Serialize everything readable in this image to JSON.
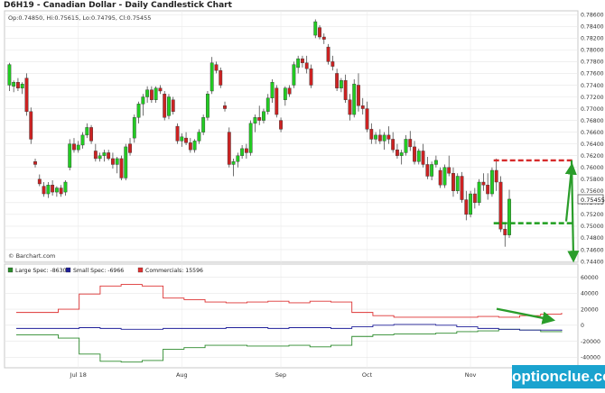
{
  "chart_title": "D6H19 - Canadian Dollar - Daily Candlestick Chart",
  "ohlc_readout": "Op:0.74850, Hi:0.75615, Lo:0.74795, Cl:0.75455",
  "last_price_label": "0.75455",
  "source_label": "© Barchart.com",
  "watermark": "optionclue.com",
  "colors": {
    "up": "#22cc22",
    "down": "#cc2222",
    "large_spec": "#2b8a2b",
    "small_spec": "#1f1f99",
    "commercials": "#dd3333",
    "annotation": "#2a9d2a",
    "level_red": "#d62b2b",
    "level_green": "#1e9e1e"
  },
  "chart_data": [
    {
      "type": "candlestick",
      "title": "D6H19 - Canadian Dollar - Daily Candlestick Chart",
      "yticks": [
        "0.78600",
        "0.78400",
        "0.78200",
        "0.78000",
        "0.77800",
        "0.77600",
        "0.77400",
        "0.77200",
        "0.77000",
        "0.76800",
        "0.76600",
        "0.76400",
        "0.76200",
        "0.76000",
        "0.75800",
        "0.75600",
        "0.75400",
        "0.75200",
        "0.75000",
        "0.74800",
        "0.74600",
        "0.74400"
      ],
      "ylim": [
        0.744,
        0.7865
      ],
      "xticks": [
        {
          "label": "Jul 18",
          "index": 16
        },
        {
          "label": "Aug",
          "index": 40
        },
        {
          "label": "Sep",
          "index": 63
        },
        {
          "label": "Oct",
          "index": 83
        },
        {
          "label": "Nov",
          "index": 107
        }
      ],
      "num_slots": 132,
      "ohlc": [
        {
          "o": 0.774,
          "h": 0.7778,
          "l": 0.773,
          "c": 0.7775
        },
        {
          "o": 0.7738,
          "h": 0.7748,
          "l": 0.7728,
          "c": 0.7745
        },
        {
          "o": 0.7745,
          "h": 0.7752,
          "l": 0.773,
          "c": 0.7735
        },
        {
          "o": 0.7735,
          "h": 0.7745,
          "l": 0.7725,
          "c": 0.7742
        },
        {
          "o": 0.7752,
          "h": 0.776,
          "l": 0.7688,
          "c": 0.7695
        },
        {
          "o": 0.7695,
          "h": 0.7702,
          "l": 0.764,
          "c": 0.7648
        },
        {
          "o": 0.761,
          "h": 0.7615,
          "l": 0.76,
          "c": 0.7605
        },
        {
          "o": 0.758,
          "h": 0.7588,
          "l": 0.7568,
          "c": 0.7572
        },
        {
          "o": 0.7568,
          "h": 0.7575,
          "l": 0.755,
          "c": 0.7555
        },
        {
          "o": 0.7555,
          "h": 0.7575,
          "l": 0.7548,
          "c": 0.757
        },
        {
          "o": 0.757,
          "h": 0.7578,
          "l": 0.7552,
          "c": 0.7558
        },
        {
          "o": 0.7558,
          "h": 0.7568,
          "l": 0.755,
          "c": 0.7565
        },
        {
          "o": 0.7565,
          "h": 0.757,
          "l": 0.755,
          "c": 0.7555
        },
        {
          "o": 0.7558,
          "h": 0.7578,
          "l": 0.7552,
          "c": 0.7575
        },
        {
          "o": 0.76,
          "h": 0.7648,
          "l": 0.7595,
          "c": 0.764
        },
        {
          "o": 0.764,
          "h": 0.765,
          "l": 0.7625,
          "c": 0.763
        },
        {
          "o": 0.763,
          "h": 0.7645,
          "l": 0.7625,
          "c": 0.7638
        },
        {
          "o": 0.7638,
          "h": 0.766,
          "l": 0.7632,
          "c": 0.7655
        },
        {
          "o": 0.7655,
          "h": 0.7675,
          "l": 0.765,
          "c": 0.7668
        },
        {
          "o": 0.7668,
          "h": 0.7672,
          "l": 0.764,
          "c": 0.7645
        },
        {
          "o": 0.7628,
          "h": 0.764,
          "l": 0.761,
          "c": 0.7615
        },
        {
          "o": 0.7615,
          "h": 0.7625,
          "l": 0.761,
          "c": 0.762
        },
        {
          "o": 0.762,
          "h": 0.763,
          "l": 0.761,
          "c": 0.7625
        },
        {
          "o": 0.7625,
          "h": 0.763,
          "l": 0.7612,
          "c": 0.7615
        },
        {
          "o": 0.7615,
          "h": 0.7625,
          "l": 0.7598,
          "c": 0.7605
        },
        {
          "o": 0.7605,
          "h": 0.7618,
          "l": 0.759,
          "c": 0.7615
        },
        {
          "o": 0.7615,
          "h": 0.762,
          "l": 0.7578,
          "c": 0.7582
        },
        {
          "o": 0.7582,
          "h": 0.764,
          "l": 0.7578,
          "c": 0.7635
        },
        {
          "o": 0.764,
          "h": 0.765,
          "l": 0.762,
          "c": 0.7625
        },
        {
          "o": 0.765,
          "h": 0.769,
          "l": 0.7642,
          "c": 0.7685
        },
        {
          "o": 0.7685,
          "h": 0.7712,
          "l": 0.7675,
          "c": 0.7708
        },
        {
          "o": 0.7708,
          "h": 0.7725,
          "l": 0.7688,
          "c": 0.772
        },
        {
          "o": 0.772,
          "h": 0.7738,
          "l": 0.771,
          "c": 0.7732
        },
        {
          "o": 0.7732,
          "h": 0.7738,
          "l": 0.771,
          "c": 0.7715
        },
        {
          "o": 0.7715,
          "h": 0.7738,
          "l": 0.771,
          "c": 0.7735
        },
        {
          "o": 0.7735,
          "h": 0.774,
          "l": 0.7725,
          "c": 0.773
        },
        {
          "o": 0.7725,
          "h": 0.773,
          "l": 0.768,
          "c": 0.7685
        },
        {
          "o": 0.7688,
          "h": 0.7725,
          "l": 0.7682,
          "c": 0.772
        },
        {
          "o": 0.7715,
          "h": 0.772,
          "l": 0.769,
          "c": 0.7695
        },
        {
          "o": 0.767,
          "h": 0.7675,
          "l": 0.764,
          "c": 0.7645
        },
        {
          "o": 0.7645,
          "h": 0.7658,
          "l": 0.7635,
          "c": 0.7652
        },
        {
          "o": 0.765,
          "h": 0.766,
          "l": 0.7638,
          "c": 0.7642
        },
        {
          "o": 0.7642,
          "h": 0.765,
          "l": 0.7625,
          "c": 0.763
        },
        {
          "o": 0.763,
          "h": 0.7648,
          "l": 0.7625,
          "c": 0.7645
        },
        {
          "o": 0.7645,
          "h": 0.7665,
          "l": 0.764,
          "c": 0.766
        },
        {
          "o": 0.766,
          "h": 0.769,
          "l": 0.7655,
          "c": 0.7685
        },
        {
          "o": 0.7685,
          "h": 0.773,
          "l": 0.768,
          "c": 0.7725
        },
        {
          "o": 0.773,
          "h": 0.7788,
          "l": 0.7725,
          "c": 0.7778
        },
        {
          "o": 0.7775,
          "h": 0.778,
          "l": 0.776,
          "c": 0.7765
        },
        {
          "o": 0.7765,
          "h": 0.777,
          "l": 0.7735,
          "c": 0.774
        },
        {
          "o": 0.7705,
          "h": 0.7712,
          "l": 0.7695,
          "c": 0.77
        },
        {
          "o": 0.766,
          "h": 0.7668,
          "l": 0.76,
          "c": 0.7605
        },
        {
          "o": 0.7605,
          "h": 0.7615,
          "l": 0.7585,
          "c": 0.761
        },
        {
          "o": 0.761,
          "h": 0.7625,
          "l": 0.76,
          "c": 0.762
        },
        {
          "o": 0.762,
          "h": 0.7638,
          "l": 0.7615,
          "c": 0.7632
        },
        {
          "o": 0.7632,
          "h": 0.764,
          "l": 0.7615,
          "c": 0.7625
        },
        {
          "o": 0.7625,
          "h": 0.768,
          "l": 0.762,
          "c": 0.7675
        },
        {
          "o": 0.7675,
          "h": 0.769,
          "l": 0.766,
          "c": 0.7685
        },
        {
          "o": 0.7685,
          "h": 0.7705,
          "l": 0.7672,
          "c": 0.768
        },
        {
          "o": 0.768,
          "h": 0.77,
          "l": 0.7675,
          "c": 0.7695
        },
        {
          "o": 0.7695,
          "h": 0.7725,
          "l": 0.769,
          "c": 0.7718
        },
        {
          "o": 0.7718,
          "h": 0.775,
          "l": 0.771,
          "c": 0.7745
        },
        {
          "o": 0.7735,
          "h": 0.774,
          "l": 0.7685,
          "c": 0.769
        },
        {
          "o": 0.768,
          "h": 0.7685,
          "l": 0.766,
          "c": 0.7665
        },
        {
          "o": 0.7715,
          "h": 0.7738,
          "l": 0.7705,
          "c": 0.7735
        },
        {
          "o": 0.7735,
          "h": 0.774,
          "l": 0.772,
          "c": 0.7725
        },
        {
          "o": 0.774,
          "h": 0.778,
          "l": 0.7735,
          "c": 0.7775
        },
        {
          "o": 0.777,
          "h": 0.779,
          "l": 0.776,
          "c": 0.7785
        },
        {
          "o": 0.7785,
          "h": 0.779,
          "l": 0.777,
          "c": 0.7778
        },
        {
          "o": 0.7778,
          "h": 0.779,
          "l": 0.776,
          "c": 0.7768
        },
        {
          "o": 0.7768,
          "h": 0.7775,
          "l": 0.7735,
          "c": 0.774
        },
        {
          "o": 0.7825,
          "h": 0.7852,
          "l": 0.782,
          "c": 0.7848
        },
        {
          "o": 0.7838,
          "h": 0.7842,
          "l": 0.7818,
          "c": 0.7822
        },
        {
          "o": 0.7822,
          "h": 0.7828,
          "l": 0.781,
          "c": 0.7818
        },
        {
          "o": 0.7805,
          "h": 0.781,
          "l": 0.7775,
          "c": 0.778
        },
        {
          "o": 0.778,
          "h": 0.779,
          "l": 0.7765,
          "c": 0.7772
        },
        {
          "o": 0.776,
          "h": 0.7768,
          "l": 0.773,
          "c": 0.7735
        },
        {
          "o": 0.7735,
          "h": 0.7752,
          "l": 0.7728,
          "c": 0.7748
        },
        {
          "o": 0.7748,
          "h": 0.7758,
          "l": 0.771,
          "c": 0.7715
        },
        {
          "o": 0.7715,
          "h": 0.7725,
          "l": 0.768,
          "c": 0.769
        },
        {
          "o": 0.769,
          "h": 0.775,
          "l": 0.7685,
          "c": 0.7742
        },
        {
          "o": 0.774,
          "h": 0.776,
          "l": 0.7695,
          "c": 0.7705
        },
        {
          "o": 0.7705,
          "h": 0.7718,
          "l": 0.769,
          "c": 0.77
        },
        {
          "o": 0.77,
          "h": 0.7712,
          "l": 0.766,
          "c": 0.7665
        },
        {
          "o": 0.7665,
          "h": 0.7675,
          "l": 0.764,
          "c": 0.7648
        },
        {
          "o": 0.7648,
          "h": 0.766,
          "l": 0.764,
          "c": 0.7655
        },
        {
          "o": 0.7655,
          "h": 0.7665,
          "l": 0.764,
          "c": 0.7645
        },
        {
          "o": 0.7645,
          "h": 0.766,
          "l": 0.763,
          "c": 0.7655
        },
        {
          "o": 0.7655,
          "h": 0.767,
          "l": 0.764,
          "c": 0.7648
        },
        {
          "o": 0.7648,
          "h": 0.766,
          "l": 0.7625,
          "c": 0.763
        },
        {
          "o": 0.763,
          "h": 0.764,
          "l": 0.7615,
          "c": 0.762
        },
        {
          "o": 0.762,
          "h": 0.763,
          "l": 0.7605,
          "c": 0.7625
        },
        {
          "o": 0.7625,
          "h": 0.7655,
          "l": 0.762,
          "c": 0.7648
        },
        {
          "o": 0.7648,
          "h": 0.7662,
          "l": 0.7628,
          "c": 0.7635
        },
        {
          "o": 0.7635,
          "h": 0.7645,
          "l": 0.7605,
          "c": 0.761
        },
        {
          "o": 0.761,
          "h": 0.7632,
          "l": 0.7605,
          "c": 0.7628
        },
        {
          "o": 0.7628,
          "h": 0.764,
          "l": 0.76,
          "c": 0.7605
        },
        {
          "o": 0.7605,
          "h": 0.7618,
          "l": 0.758,
          "c": 0.7585
        },
        {
          "o": 0.7585,
          "h": 0.761,
          "l": 0.7578,
          "c": 0.7605
        },
        {
          "o": 0.7605,
          "h": 0.762,
          "l": 0.76,
          "c": 0.7612
        },
        {
          "o": 0.7595,
          "h": 0.76,
          "l": 0.7565,
          "c": 0.757
        },
        {
          "o": 0.757,
          "h": 0.7605,
          "l": 0.7565,
          "c": 0.76
        },
        {
          "o": 0.76,
          "h": 0.762,
          "l": 0.7585,
          "c": 0.759
        },
        {
          "o": 0.759,
          "h": 0.76,
          "l": 0.755,
          "c": 0.756
        },
        {
          "o": 0.756,
          "h": 0.759,
          "l": 0.7555,
          "c": 0.7585
        },
        {
          "o": 0.7585,
          "h": 0.7592,
          "l": 0.754,
          "c": 0.7545
        },
        {
          "o": 0.7545,
          "h": 0.756,
          "l": 0.751,
          "c": 0.752
        },
        {
          "o": 0.752,
          "h": 0.756,
          "l": 0.7515,
          "c": 0.7555
        },
        {
          "o": 0.7555,
          "h": 0.7565,
          "l": 0.753,
          "c": 0.754
        },
        {
          "o": 0.754,
          "h": 0.758,
          "l": 0.7535,
          "c": 0.7575
        },
        {
          "o": 0.7575,
          "h": 0.759,
          "l": 0.756,
          "c": 0.757
        },
        {
          "o": 0.757,
          "h": 0.759,
          "l": 0.7545,
          "c": 0.7555
        },
        {
          "o": 0.7555,
          "h": 0.76,
          "l": 0.755,
          "c": 0.7595
        },
        {
          "o": 0.7595,
          "h": 0.7615,
          "l": 0.756,
          "c": 0.7575
        },
        {
          "o": 0.7575,
          "h": 0.7585,
          "l": 0.749,
          "c": 0.7495
        },
        {
          "o": 0.7495,
          "h": 0.7505,
          "l": 0.7465,
          "c": 0.7485
        },
        {
          "o": 0.7485,
          "h": 0.7562,
          "l": 0.748,
          "c": 0.7546
        }
      ],
      "levels": [
        {
          "value": 0.7612,
          "color": "level_red"
        },
        {
          "value": 0.7505,
          "color": "level_green"
        }
      ]
    },
    {
      "type": "line",
      "yticks": [
        "60000",
        "40000",
        "20000",
        "0",
        "-20000",
        "-40000"
      ],
      "ylim": [
        -52000,
        64000
      ],
      "x_weeks": [
        0,
        5,
        10,
        15,
        20,
        25,
        30,
        35,
        40,
        45,
        50,
        55,
        60,
        65,
        70,
        75,
        80,
        85,
        90,
        95,
        100,
        105,
        110,
        115,
        120,
        125,
        130
      ],
      "series": [
        {
          "name": "Large Spec: -8630",
          "color": "large_spec",
          "values": [
            -12000,
            -12000,
            -16000,
            -36000,
            -45000,
            -46000,
            -44000,
            -30000,
            -28000,
            -25000,
            -25000,
            -26000,
            -26000,
            -25000,
            -27000,
            -25000,
            -14000,
            -12000,
            -11000,
            -11000,
            -10000,
            -8000,
            -7000,
            -5000,
            -6000,
            -8000,
            -8630
          ]
        },
        {
          "name": "Small Spec: -6966",
          "color": "small_spec",
          "values": [
            -4000,
            -4000,
            -4000,
            -3000,
            -4000,
            -5000,
            -5000,
            -4000,
            -4000,
            -4000,
            -3000,
            -3000,
            -4000,
            -3000,
            -3000,
            -4000,
            -2000,
            0,
            1000,
            1000,
            0,
            -2000,
            -4000,
            -5000,
            -6000,
            -6000,
            -6966
          ]
        },
        {
          "name": "Commercials: 15596",
          "color": "commercials",
          "values": [
            16000,
            16000,
            20000,
            39000,
            49000,
            51000,
            49000,
            34000,
            32000,
            29000,
            28000,
            29000,
            30000,
            28000,
            30000,
            29000,
            16000,
            12000,
            10000,
            10000,
            10000,
            10000,
            11000,
            10000,
            12000,
            14000,
            15596
          ]
        }
      ]
    }
  ]
}
